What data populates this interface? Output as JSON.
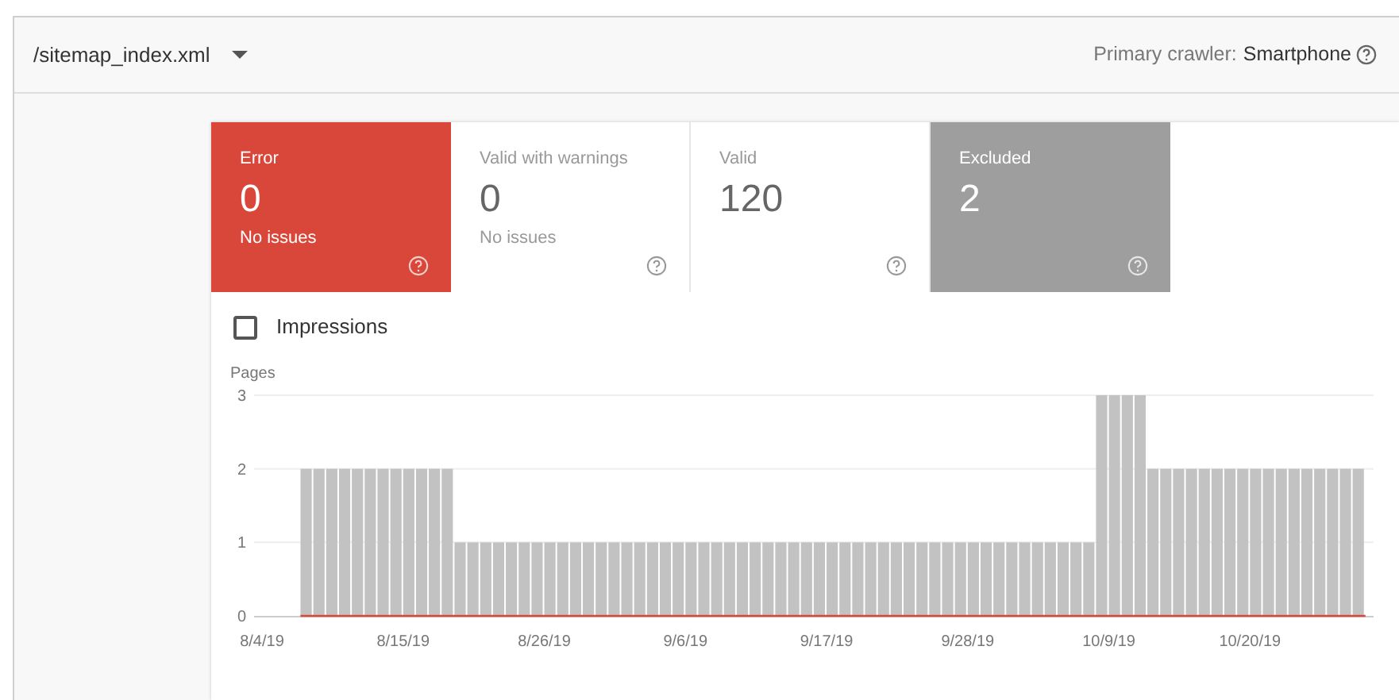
{
  "header": {
    "sitemap": "/sitemap_index.xml",
    "crawler_label": "Primary crawler:",
    "crawler_value": "Smartphone"
  },
  "tiles": [
    {
      "label": "Error",
      "value": "0",
      "note": "No issues",
      "selected": true,
      "color": "#d9473a"
    },
    {
      "label": "Valid with warnings",
      "value": "0",
      "note": "No issues",
      "selected": false
    },
    {
      "label": "Valid",
      "value": "120",
      "selected": false
    },
    {
      "label": "Excluded",
      "value": "2",
      "selected": true,
      "color": "#9e9e9e"
    }
  ],
  "impressions": {
    "label": "Impressions",
    "checked": false
  },
  "chart": {
    "chart_data": {
      "type": "bar",
      "ylabel": "Pages",
      "ylim": [
        0,
        3
      ],
      "yticks": [
        0,
        1,
        2,
        3
      ],
      "categories": [
        "8/4/19",
        null,
        null,
        null,
        null,
        null,
        null,
        null,
        null,
        null,
        null,
        "8/15/19",
        null,
        null,
        null,
        null,
        null,
        null,
        null,
        null,
        null,
        null,
        "8/26/19",
        null,
        null,
        null,
        null,
        null,
        null,
        null,
        null,
        null,
        null,
        "9/6/19",
        null,
        null,
        null,
        null,
        null,
        null,
        null,
        null,
        null,
        null,
        "9/17/19",
        null,
        null,
        null,
        null,
        null,
        null,
        null,
        null,
        null,
        null,
        "9/28/19",
        null,
        null,
        null,
        null,
        null,
        null,
        null,
        null,
        null,
        null,
        "10/9/19",
        null,
        null,
        null,
        null,
        null,
        null,
        null,
        null,
        null,
        null,
        "10/20/19",
        null,
        null,
        null,
        null,
        null,
        null,
        null,
        null
      ],
      "series": [
        {
          "color": "#c2c2c2",
          "values": [
            null,
            null,
            null,
            2,
            2,
            2,
            2,
            2,
            2,
            2,
            2,
            2,
            2,
            2,
            2,
            1,
            1,
            1,
            1,
            1,
            1,
            1,
            1,
            1,
            1,
            1,
            1,
            1,
            1,
            1,
            1,
            1,
            1,
            1,
            1,
            1,
            1,
            1,
            1,
            1,
            1,
            1,
            1,
            1,
            1,
            1,
            1,
            1,
            1,
            1,
            1,
            1,
            1,
            1,
            1,
            1,
            1,
            1,
            1,
            1,
            1,
            1,
            1,
            1,
            1,
            3,
            3,
            3,
            3,
            2,
            2,
            2,
            2,
            2,
            2,
            2,
            2,
            2,
            2,
            2,
            2,
            2,
            2,
            2,
            2,
            2
          ]
        }
      ]
    }
  }
}
